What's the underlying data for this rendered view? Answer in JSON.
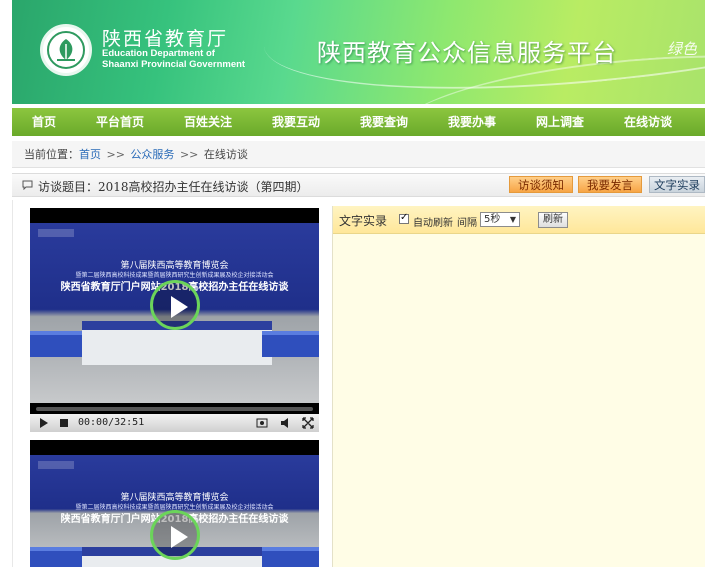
{
  "header": {
    "org_name_cn": "陕西省教育厅",
    "org_name_en_1": "Education Department of",
    "org_name_en_2": "Shaanxi Provincial Government",
    "platform_title": "陕西教育公众信息服务平台",
    "slogan": "绿色"
  },
  "nav": {
    "items": [
      "首页",
      "平台首页",
      "百姓关注",
      "我要互动",
      "我要查询",
      "我要办事",
      "网上调查",
      "在线访谈"
    ]
  },
  "breadcrumb": {
    "prefix": "当前位置：",
    "home": "首页",
    "sep": ">>",
    "section": "公众服务",
    "current": "在线访谈"
  },
  "topic": {
    "title": "访谈题目：2018高校招办主任在线访谈（第四期）",
    "tabs": [
      "访谈须知",
      "我要发言",
      "文字实录"
    ]
  },
  "video": {
    "screen_line1": "第八届陕西高等教育博览会",
    "screen_line2": "暨第二届陕西高校科技成果暨首届陕西研究生创新成果展及校企对接活动会",
    "screen_line3": "陕西省教育厅门户网站2018高校招办主任在线访谈",
    "time": "00:00/32:51"
  },
  "transcript": {
    "label": "文字实录",
    "auto_refresh_label": "自动刷新",
    "interval_label": "间隔",
    "interval_value": "5秒",
    "refresh_button": "刷新"
  },
  "colors": {
    "nav_green": "#7ab835",
    "tab_orange": "#f7a546",
    "link_blue": "#2a6bb8",
    "panel_yellow": "#fffde6"
  }
}
